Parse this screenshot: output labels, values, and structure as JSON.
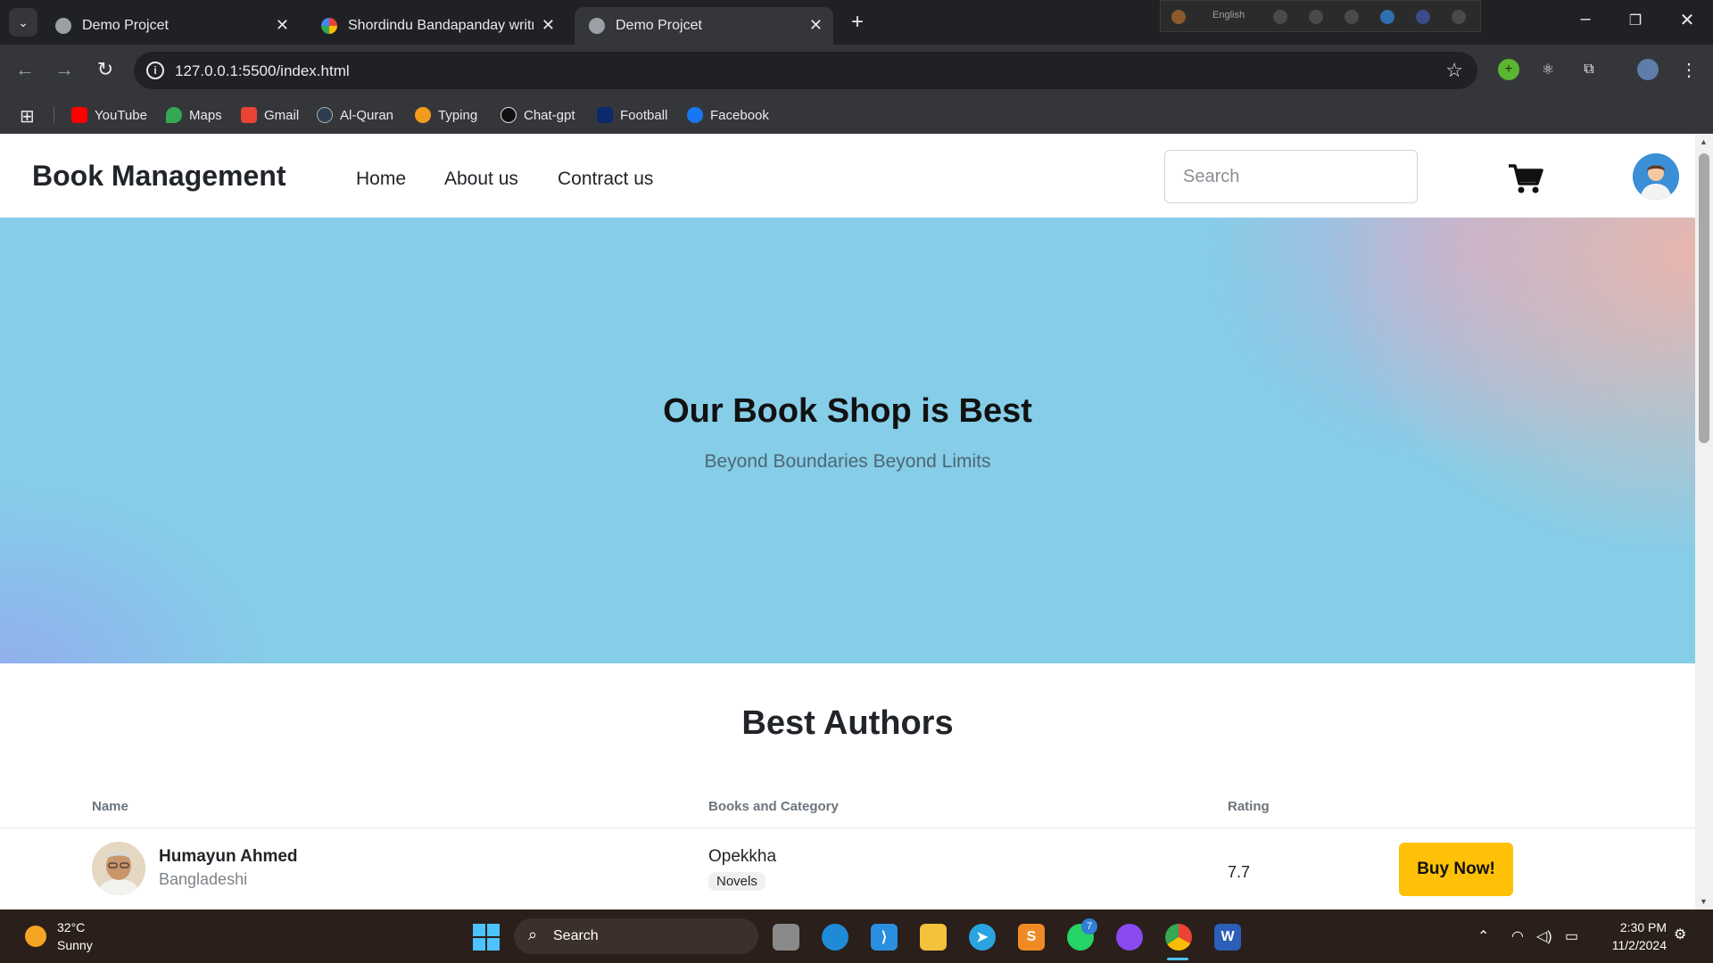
{
  "browser": {
    "tabs": [
      {
        "title": "Demo Projcet",
        "active": false
      },
      {
        "title": "Shordindu Bandapanday writr -",
        "active": false
      },
      {
        "title": "Demo Projcet",
        "active": true
      }
    ],
    "language_bar": "English",
    "url": "127.0.0.1:5500/index.html",
    "bookmarks": [
      "YouTube",
      "Maps",
      "Gmail",
      "Al-Quran",
      "Typing",
      "Chat-gpt",
      "Football",
      "Facebook"
    ]
  },
  "site": {
    "brand": "Book Management",
    "nav": [
      "Home",
      "About us",
      "Contract us"
    ],
    "search_placeholder": "Search",
    "hero": {
      "title": "Our Book Shop is Best",
      "subtitle": "Beyond Boundaries Beyond Limits"
    },
    "authors": {
      "title": "Best Authors",
      "headers": [
        "Name",
        "Books and Category",
        "Rating"
      ],
      "rows": [
        {
          "name": "Humayun Ahmed",
          "country": "Bangladeshi",
          "book": "Opekkha",
          "category": "Novels",
          "rating": "7.7",
          "action": "Buy Now!"
        }
      ]
    }
  },
  "taskbar": {
    "weather_temp": "32°C",
    "weather_condition": "Sunny",
    "search_label": "Search",
    "whatsapp_badge": "7",
    "time": "2:30 PM",
    "date": "11/2/2024"
  },
  "colors": {
    "buy_button": "#ffc107",
    "hero_base": "#86cde8",
    "chrome_dark": "#202124"
  }
}
